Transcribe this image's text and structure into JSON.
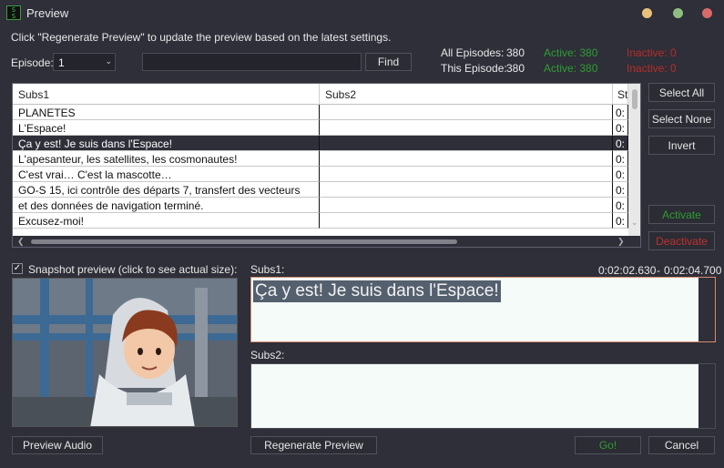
{
  "window": {
    "title": "Preview",
    "icon_name": "app-logo-icon"
  },
  "hint": "Click \"Regenerate Preview\" to update the preview based on the latest settings.",
  "episode": {
    "label": "Episode:",
    "value": "1"
  },
  "find": {
    "value": "",
    "button": "Find"
  },
  "stats": {
    "all_label": "All Episodes:",
    "all_total": "380",
    "all_active": "Active: 380",
    "all_inactive": "Inactive: 0",
    "this_label": "This Episode:",
    "this_total": "380",
    "this_active": "Active: 380",
    "this_inactive": "Inactive: 0"
  },
  "table": {
    "columns": [
      "Subs1",
      "Subs2",
      "St"
    ],
    "rows": [
      {
        "subs1": "PLANETES",
        "subs2": "",
        "st": "0:"
      },
      {
        "subs1": "L'Espace!",
        "subs2": "",
        "st": "0:"
      },
      {
        "subs1": "Ça y est! Je suis dans l'Espace!",
        "subs2": "",
        "st": "0:"
      },
      {
        "subs1": "L'apesanteur, les satellites, les cosmonautes!",
        "subs2": "",
        "st": "0:"
      },
      {
        "subs1": "C'est vrai… C'est la mascotte…",
        "subs2": "",
        "st": "0:"
      },
      {
        "subs1": "GO-S 15, ici contrôle des départs 7, transfert des vecteurs",
        "subs2": "",
        "st": "0:"
      },
      {
        "subs1": "et des données de navigation terminé.",
        "subs2": "",
        "st": "0:"
      },
      {
        "subs1": "Excusez-moi!",
        "subs2": "",
        "st": "0:"
      }
    ],
    "selected_index": 2
  },
  "side_buttons": {
    "select_all": "Select All",
    "select_none": "Select None",
    "invert": "Invert",
    "activate": "Activate",
    "deactivate": "Deactivate"
  },
  "snapshot": {
    "label": "Snapshot preview (click to see actual size):",
    "checked": "✓"
  },
  "subs1": {
    "label": "Subs1:",
    "time_start": "0:02:02.630",
    "time_sep": "-",
    "time_end": "0:02:04.700",
    "text": "Ça y est! Je suis dans l'Espace!"
  },
  "subs2": {
    "label": "Subs2:",
    "text": ""
  },
  "bottom_buttons": {
    "preview_audio": "Preview Audio",
    "regenerate": "Regenerate Preview",
    "go": "Go!",
    "cancel": "Cancel"
  },
  "colors": {
    "background": "#2e2f38",
    "active": "#2e9d33",
    "inactive": "#b92c2a"
  }
}
